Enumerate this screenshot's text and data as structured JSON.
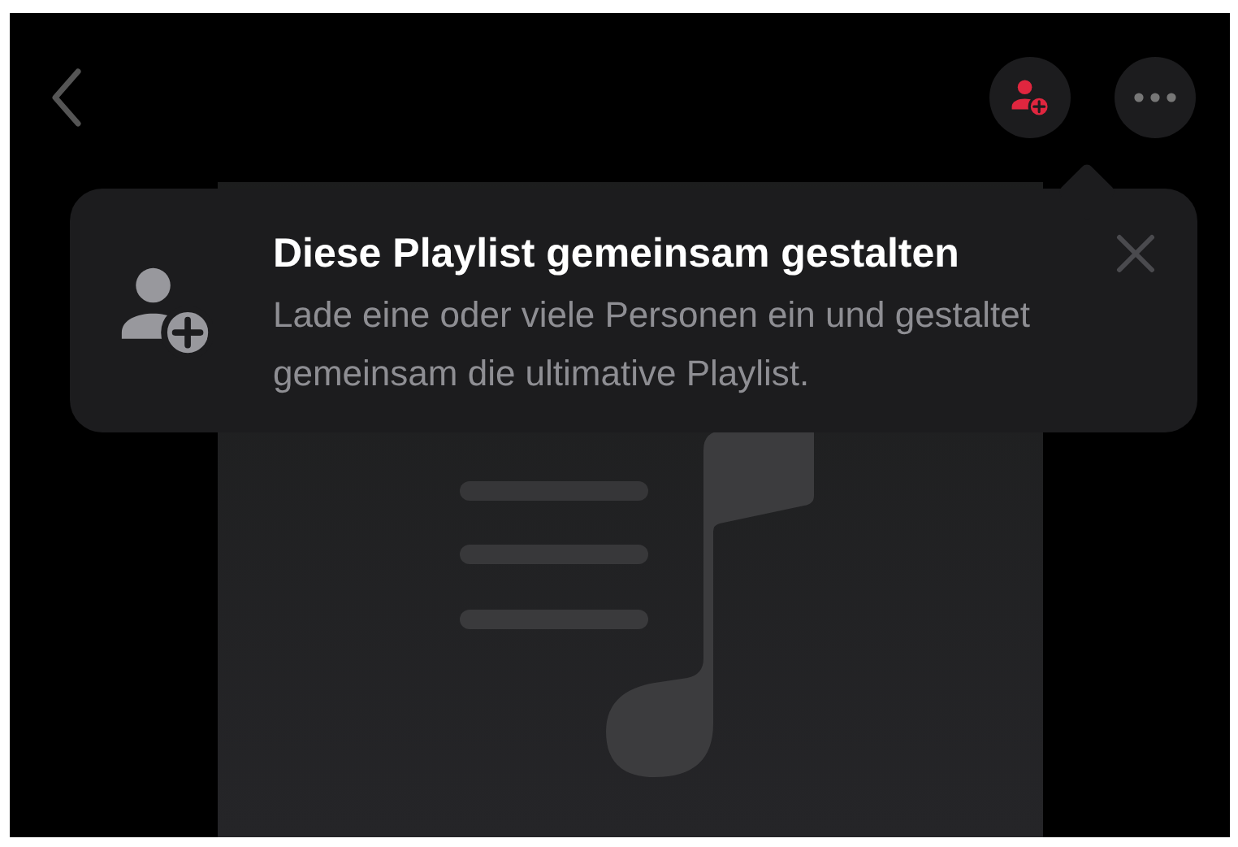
{
  "header": {
    "buttons": [
      {
        "kind": "back"
      },
      {
        "kind": "add-person"
      },
      {
        "kind": "more"
      }
    ]
  },
  "tip": {
    "title": "Diese Playlist gemeinsam gestalten",
    "body": "Lade eine oder viele Personen ein und gestaltet gemeinsam die ultimative Playlist."
  }
}
